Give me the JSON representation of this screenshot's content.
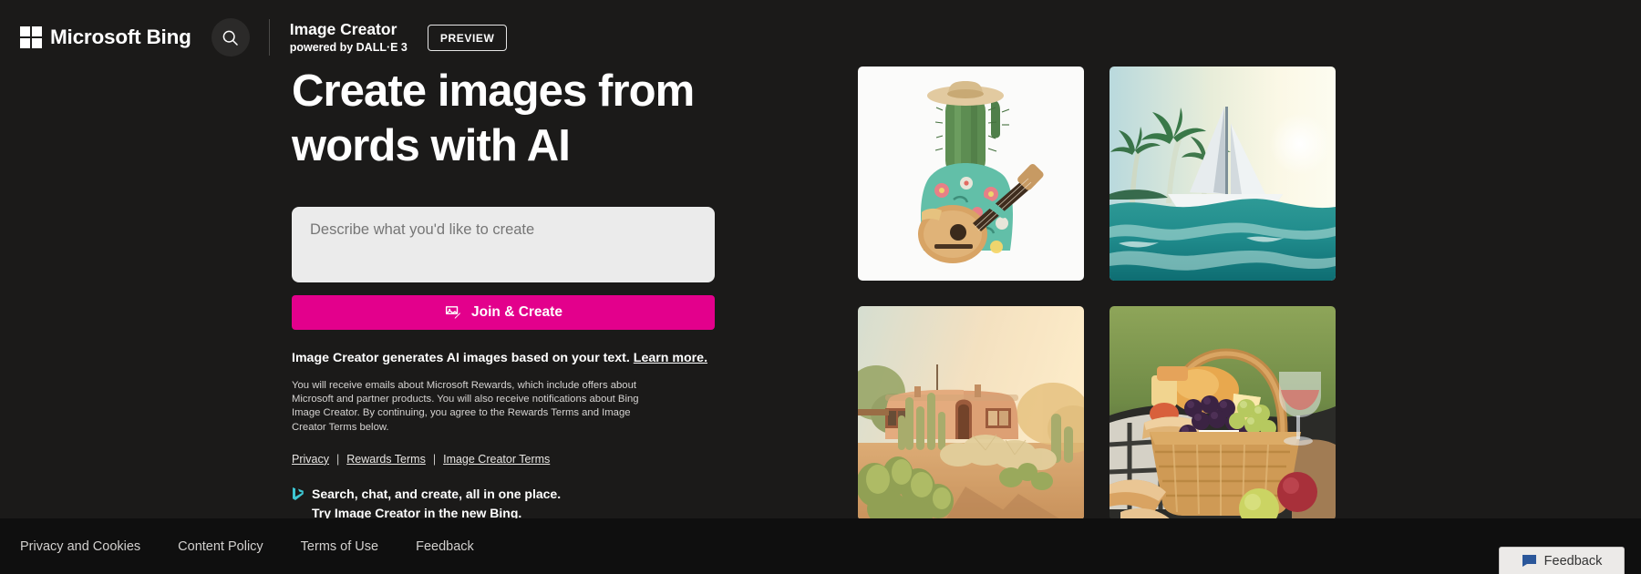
{
  "header": {
    "brand": "Microsoft Bing",
    "search_icon": "search-icon",
    "app_title": "Image Creator",
    "app_subtitle": "powered by DALL·E 3",
    "preview_badge": "PREVIEW"
  },
  "hero": {
    "headline": "Create images from words with AI",
    "prompt_placeholder": "Describe what you'd like to create",
    "prompt_value": "",
    "join_button": "Join & Create",
    "join_button_icon": "image-edit-icon",
    "generates_note": "Image Creator generates AI images based on your text.",
    "learn_more": "Learn more.",
    "disclaimer": "You will receive emails about Microsoft Rewards, which include offers about Microsoft and partner products. You will also receive notifications about Bing Image Creator. By continuing, you agree to the Rewards Terms and Image Creator Terms below.",
    "legal_links": [
      {
        "label": "Privacy"
      },
      {
        "label": "Rewards Terms"
      },
      {
        "label": "Image Creator Terms"
      }
    ],
    "legal_separator": "|",
    "promo_icon": "bing-logo-icon",
    "promo_line1": "Search, chat, and create, all in one place.",
    "promo_link": "Try Image Creator in the new Bing."
  },
  "gallery": {
    "tiles": [
      {
        "name": "cactus-guitarist",
        "alt": "Cactus wearing a straw hat and floral shirt playing an acoustic guitar on a white background"
      },
      {
        "name": "paper-sailboat-ocean",
        "alt": "Stylized sailboat on turquoise ocean waves with palm trees and sun in the background"
      },
      {
        "name": "adobe-desert-house",
        "alt": "Adobe desert house at golden hour surrounded by cacti and dry shrubs"
      },
      {
        "name": "picnic-basket",
        "alt": "Wicker picnic basket filled with grapes, cheese, bread and fruit with a glass of rose wine"
      }
    ]
  },
  "footer": {
    "links": [
      {
        "label": "Privacy and Cookies"
      },
      {
        "label": "Content Policy"
      },
      {
        "label": "Terms of Use"
      },
      {
        "label": "Feedback"
      }
    ],
    "feedback_button": "Feedback",
    "feedback_icon": "speech-bubble-icon"
  },
  "colors": {
    "background": "#1b1a19",
    "footer_background": "#0f0f0f",
    "accent_pink": "#e3008c",
    "input_background": "#ebebeb",
    "text_primary": "#ffffff",
    "bing_teal": "#3ec6d2"
  }
}
